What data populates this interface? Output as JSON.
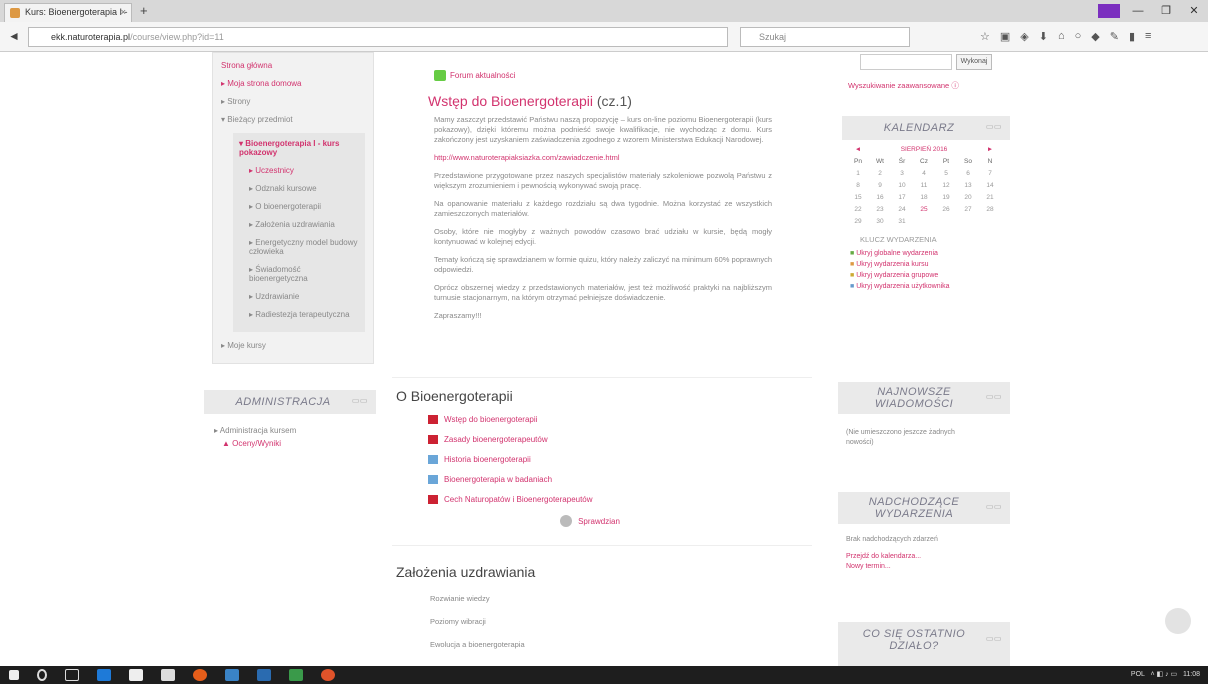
{
  "browser": {
    "tab_title": "Kurs: Bioenergoterapia I - ...",
    "tab_close": "×",
    "new_tab": "+",
    "url_host": "ekk.naturoterapia.pl",
    "url_path": "/course/view.php?id=11",
    "search_placeholder": "Szukaj",
    "window_controls": [
      "—",
      "❐",
      "✕"
    ]
  },
  "left_nav": {
    "items": [
      {
        "label": "Strona główna",
        "style": "link"
      },
      {
        "label": "Moja strona domowa",
        "style": "link"
      },
      {
        "label": "Strony",
        "style": "dim"
      },
      {
        "label": "Bieżący przedmiot",
        "style": "dim"
      }
    ],
    "current_course": "Bioenergoterapia I - kurs pokazowy",
    "sub_items": [
      "Uczestnicy",
      "Odznaki kursowe",
      "O bioenergoterapii",
      "Założenia uzdrawiania",
      "Energetyczny model budowy człowieka",
      "Świadomość bioenergetyczna",
      "Uzdrawianie",
      "Radiestezja terapeutyczna"
    ],
    "my_courses": "Moje kursy"
  },
  "admin_block": {
    "title": "ADMINISTRACJA",
    "controls": "▭▭",
    "item_course_admin": "Administracja kursem",
    "item_grades": "Oceny/Wyniki"
  },
  "main": {
    "forum_link": "Forum aktualności",
    "intro_title": "Wstęp do Bioenergoterapii",
    "intro_part": "(cz.1)",
    "paragraphs": [
      "Mamy zaszczyt przedstawić Państwu naszą propozycję – kurs on-line poziomu Bioenergoterapii (kurs pokazowy), dzięki któremu można podnieść swoje kwalifikacje, nie wychodząc z domu. Kurs zakończony jest uzyskaniem zaświadczenia zgodnego z wzorem Ministerstwa Edukacji Narodowej.",
      "Przedstawione przygotowane przez naszych specjalistów materiały szkoleniowe pozwolą Państwu z większym zrozumieniem i pewnością wykonywać swoją pracę.",
      "Na opanowanie materiału z każdego rozdziału są dwa tygodnie. Można korzystać ze wszystkich zamieszczonych materiałów.",
      "Osoby, które nie mogłyby z ważnych powodów czasowo brać udziału w kursie, będą mogły kontynuować w kolejnej edycji.",
      "Tematy kończą się sprawdzianem w formie quizu, który należy zaliczyć na minimum 60% poprawnych odpowiedzi.",
      "Oprócz obszernej wiedzy z przedstawionych materiałów, jest też możliwość praktyki na najbliższym turnusie stacjonarnym, na którym otrzymać pełniejsze doświadczenie."
    ],
    "link_line": "http://www.naturoterapiaksiazka.com/zawiadczenie.html",
    "closing": "Zapraszamy!!!",
    "section2_title": "O Bioenergoterapii",
    "section2_items": [
      {
        "label": "Wstęp do bioenergoterapii",
        "icon": "pdf-icon"
      },
      {
        "label": "Zasady bioenergoterapeutów",
        "icon": "pdf-icon"
      },
      {
        "label": "Historia bioenergoterapii",
        "icon": "folder-icon"
      },
      {
        "label": "Bioenergoterapia w badaniach",
        "icon": "folder-icon"
      },
      {
        "label": "Cech Naturopatów i Bioenergoterapeutów",
        "icon": "pdf-icon"
      }
    ],
    "section2_quiz": "Sprawdzian",
    "section3_title": "Założenia uzdrawiania",
    "section3_items": [
      "Rozwianie wiedzy",
      "Poziomy wibracji",
      "Ewolucja a bioenergoterapia"
    ]
  },
  "right": {
    "search_button": "Wykonaj",
    "advanced_search": "Wyszukiwanie zaawansowane",
    "calendar": {
      "title": "KALENDARZ",
      "controls": "▭▭",
      "month": "SIERPIEŃ 2016",
      "prev": "◄",
      "next": "►",
      "weekdays": [
        "Pn",
        "Wt",
        "Śr",
        "Cz",
        "Pt",
        "So",
        "N"
      ],
      "weeks": [
        [
          "1",
          "2",
          "3",
          "4",
          "5",
          "6",
          "7"
        ],
        [
          "8",
          "9",
          "10",
          "11",
          "12",
          "13",
          "14"
        ],
        [
          "15",
          "16",
          "17",
          "18",
          "19",
          "20",
          "21"
        ],
        [
          "22",
          "23",
          "24",
          "25",
          "26",
          "27",
          "28"
        ],
        [
          "29",
          "30",
          "31",
          "",
          "",
          "",
          ""
        ]
      ],
      "legend_title": "KLUCZ WYDARZENIA",
      "legend": [
        "Ukryj globalne wydarzenia",
        "Ukryj wydarzenia kursu",
        "Ukryj wydarzenia grupowe",
        "Ukryj wydarzenia użytkownika"
      ]
    },
    "news": {
      "title": "NAJNOWSZE WIADOMOŚCI",
      "controls": "▭▭",
      "body": "(Nie umieszczono jeszcze żadnych nowości)"
    },
    "upcoming": {
      "title": "NADCHODZĄCE WYDARZENIA",
      "controls": "▭▭",
      "body": "Brak nadchodzących zdarzeń",
      "link1": "Przejdź do kalendarza...",
      "link2": "Nowy termin..."
    },
    "recent": {
      "title": "CO SIĘ OSTATNIO DZIAŁO?",
      "controls": "▭▭"
    }
  },
  "taskbar": {
    "clock": "11:08",
    "lang": "POL"
  }
}
